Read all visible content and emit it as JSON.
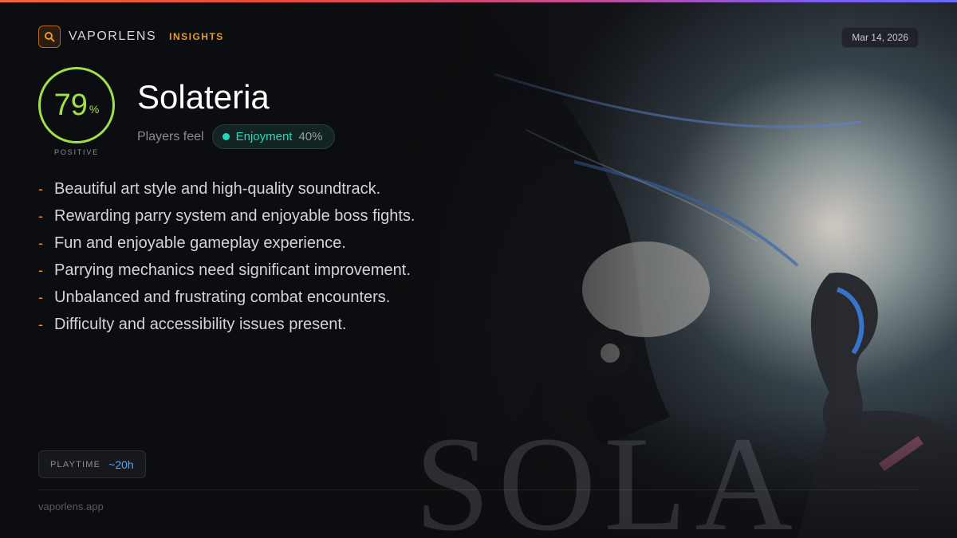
{
  "brand": {
    "name": "VAPORLENS",
    "section": "INSIGHTS"
  },
  "date": "Mar 14, 2026",
  "score": {
    "value": "79",
    "unit": "%",
    "label": "POSITIVE"
  },
  "game": {
    "title": "Solateria"
  },
  "sentiment": {
    "label": "Players feel",
    "emotion": "Enjoyment",
    "percent": "40%"
  },
  "points": [
    "Beautiful art style and high-quality soundtrack.",
    "Rewarding parry system and enjoyable boss fights.",
    "Fun and enjoyable gameplay experience.",
    "Parrying mechanics need significant improvement.",
    "Unbalanced and frustrating combat encounters.",
    "Difficulty and accessibility issues present."
  ],
  "bullet_char": "-",
  "playtime": {
    "label": "PLAYTIME",
    "value": "~20h"
  },
  "footer": "vaporlens.app",
  "art_word": "SOLA",
  "colors": {
    "accent": "#e89a2c",
    "score": "#a3e048",
    "emotion": "#2dd4bf",
    "playtime": "#4aa8ff"
  }
}
